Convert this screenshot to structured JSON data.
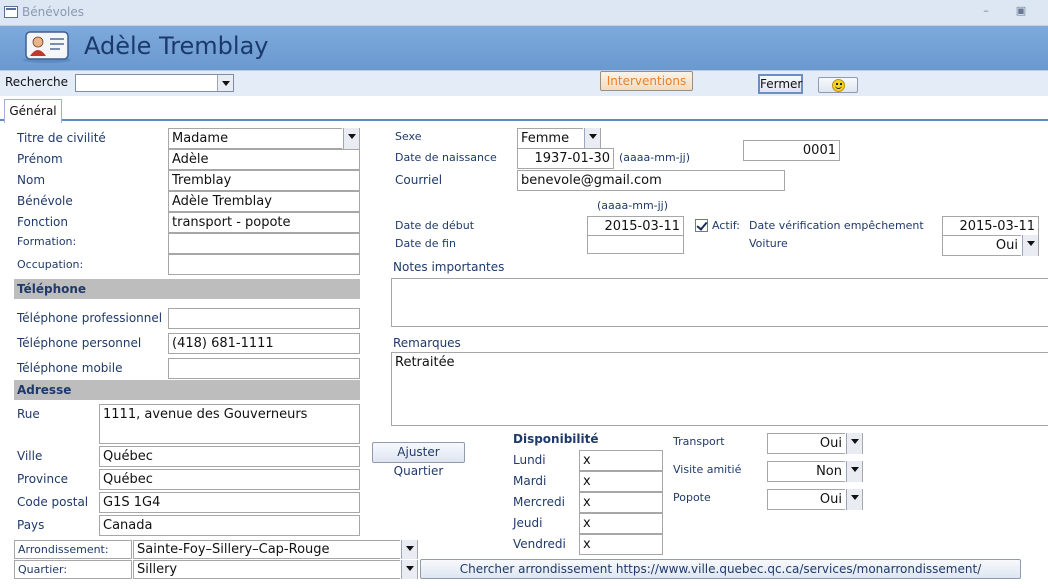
{
  "window": {
    "title": "Bénévoles",
    "minimize_icon": "minimize-icon",
    "restore_icon": "restore-icon"
  },
  "header": {
    "title": "Adèle Tremblay",
    "icon": "person-card-icon"
  },
  "search": {
    "label": "Recherche",
    "value": ""
  },
  "toolbar": {
    "interventions_label": "Interventions",
    "close_label": "Fermer",
    "smiley_icon": "smiley-icon"
  },
  "tabs": [
    {
      "label": "Général"
    }
  ],
  "identity": {
    "civility_label": "Titre de civilité",
    "civility_value": "Madame",
    "firstname_label": "Prénom",
    "firstname_value": "Adèle",
    "lastname_label": "Nom",
    "lastname_value": "Tremblay",
    "volunteer_label": "Bénévole",
    "volunteer_value": "Adèle Tremblay",
    "function_label": "Fonction",
    "function_value": "transport - popote",
    "training_label": "Formation:",
    "training_value": "",
    "occupation_label": "Occupation:",
    "occupation_value": ""
  },
  "phone": {
    "section_title": "Téléphone",
    "work_label": "Téléphone professionnel",
    "work_value": "",
    "home_label": "Téléphone personnel",
    "home_value": "(418) 681-1111",
    "mobile_label": "Téléphone mobile",
    "mobile_value": ""
  },
  "address": {
    "section_title": "Adresse",
    "street_label": "Rue",
    "street_value": "1111, avenue des Gouverneurs",
    "city_label": "Ville",
    "city_value": "Québec",
    "province_label": "Province",
    "province_value": "Québec",
    "postal_label": "Code postal",
    "postal_value": "G1S 1G4",
    "country_label": "Pays",
    "country_value": "Canada",
    "borough_label": "Arrondissement:",
    "borough_value": "Sainte-Foy–Sillery–Cap-Rouge",
    "district_label": "Quartier:",
    "district_value": "Sillery",
    "adjust_button": "Ajuster Quartier",
    "lookup_button": "Chercher arrondissement https://www.ville.quebec.qc.ca/services/monarrondissement/"
  },
  "details": {
    "sex_label": "Sexe",
    "sex_value": "Femme",
    "birth_label": "Date de naissance",
    "birth_value": "1937-01-30",
    "date_hint": "(aaaa-mm-jj)",
    "id_value": "0001",
    "email_label": "Courriel",
    "email_value": "benevole@gmail.com",
    "start_label": "Date de début",
    "start_value": "2015-03-11",
    "end_label": "Date de fin",
    "end_value": "",
    "active_label": "Actif:",
    "active_checked": true,
    "verif_label": "Date vérification empêchement",
    "verif_value": "2015-03-11",
    "car_label": "Voiture",
    "car_value": "Oui",
    "notes_label": "Notes importantes",
    "notes_value": "",
    "remarks_label": "Remarques",
    "remarks_value": "Retraitée"
  },
  "availability": {
    "title": "Disponibilité",
    "days": [
      {
        "label": "Lundi",
        "value": "x"
      },
      {
        "label": "Mardi",
        "value": "x"
      },
      {
        "label": "Mercredi",
        "value": "x"
      },
      {
        "label": "Jeudi",
        "value": "x"
      },
      {
        "label": "Vendredi",
        "value": "x"
      }
    ]
  },
  "services": [
    {
      "label": "Transport",
      "value": "Oui"
    },
    {
      "label": "Visite amitié",
      "value": "Non"
    },
    {
      "label": "Popote",
      "value": "Oui"
    }
  ]
}
